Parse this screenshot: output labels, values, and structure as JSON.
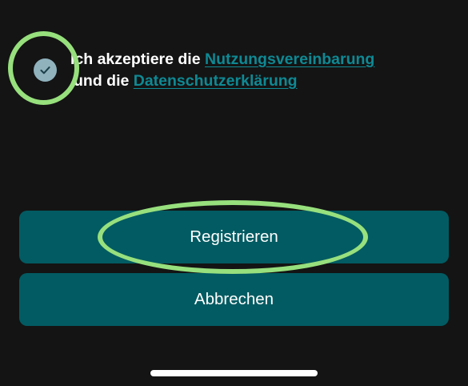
{
  "consent": {
    "checked": true,
    "text_part1": "Ich akzeptiere die ",
    "link_terms": "Nutzungsvereinbarung",
    "text_part2": "und die ",
    "link_privacy": "Datenschutzerklärung"
  },
  "buttons": {
    "register_label": "Registrieren",
    "cancel_label": "Abbrechen"
  },
  "icons": {
    "checkbox": "checkmark-icon"
  },
  "colors": {
    "background": "#141414",
    "button": "#025b62",
    "link": "#0e8994",
    "checkbox": "#8fb2bd",
    "highlight_ring": "#97e07d"
  }
}
